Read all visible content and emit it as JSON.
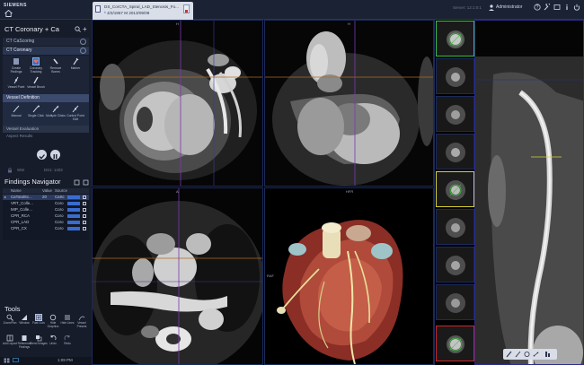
{
  "topbar": {
    "brand": "SIEMENS",
    "patient_line1": "DS_CorCTA_Spiral_LAD_Stenosis_Fo...",
    "patient_line2": "* 4/3/1957 M 2013/09/09",
    "server": "Server: 12:1:0:1",
    "user": "Administrator"
  },
  "workflow": {
    "title": "CT Coronary + Ca",
    "step_cascoring": "CT CaScoring",
    "step_coronary": "CT Coronary",
    "tools": [
      {
        "label": "Create Findings",
        "active": false
      },
      {
        "label": "Coronary Tracking",
        "active": true
      },
      {
        "label": "Remove Bones",
        "active": false
      },
      {
        "label": "Marker",
        "active": false
      },
      {
        "label": "Vessel Point",
        "active": false
      },
      {
        "label": "Vessel Brush",
        "active": false
      }
    ],
    "vessel_definition": "Vessel Definition",
    "vessel_tools": [
      {
        "label": "Manual"
      },
      {
        "label": "Single Click"
      },
      {
        "label": "Multiple Clicks"
      },
      {
        "label": "Control Point Edit"
      }
    ],
    "vessel_evaluation": "Vessel Evaluation",
    "aspect_results": "Aspect Results"
  },
  "slider": {
    "label": "WW",
    "value": "DS1: 1403"
  },
  "findings": {
    "title": "Findings Navigator",
    "columns": [
      "Name",
      "Value",
      "Source"
    ],
    "rows": [
      {
        "name": "CaTotalSc...",
        "value": "20",
        "source": "CaSc",
        "selected": true
      },
      {
        "name": "VRT_Colle...",
        "value": "",
        "source": "Coro",
        "selected": false
      },
      {
        "name": "MIP_Colle...",
        "value": "",
        "source": "Coro",
        "selected": false
      },
      {
        "name": "CPR_RCA",
        "value": "",
        "source": "Coro",
        "selected": false
      },
      {
        "name": "CPR_LAD",
        "value": "",
        "source": "Coro",
        "selected": false
      },
      {
        "name": "CPR_CX",
        "value": "",
        "source": "Coro",
        "selected": false
      }
    ]
  },
  "tools": {
    "title": "Tools",
    "items": [
      {
        "label": "Zoom/Pan",
        "active": false
      },
      {
        "label": "Window",
        "active": false
      },
      {
        "label": "Fast Cuts",
        "active": true
      },
      {
        "label": "Hide Graphics",
        "active": false
      },
      {
        "label": "Hide Lines",
        "active": false
      },
      {
        "label": "Vessel Presets",
        "active": false
      },
      {
        "label": "Add Layout",
        "active": false
      },
      {
        "label": "Reference Findings",
        "active": false
      },
      {
        "label": "Blend Images",
        "active": false
      },
      {
        "label": "Undo",
        "active": false
      },
      {
        "label": "Redo",
        "active": false
      }
    ]
  },
  "status": {
    "time": "1:09 PM"
  },
  "viewer": {
    "sag_top": "H",
    "cor_top": "H",
    "ax_top": "A",
    "vrt_top": "HFR",
    "vrt_left": "RAF",
    "sag_left": "R"
  },
  "colors": {
    "accent": "#3a6cd0",
    "panel": "#161c2a",
    "thumb_green": "#3cc040",
    "thumb_yellow": "#d8d030",
    "thumb_red": "#d02828"
  }
}
